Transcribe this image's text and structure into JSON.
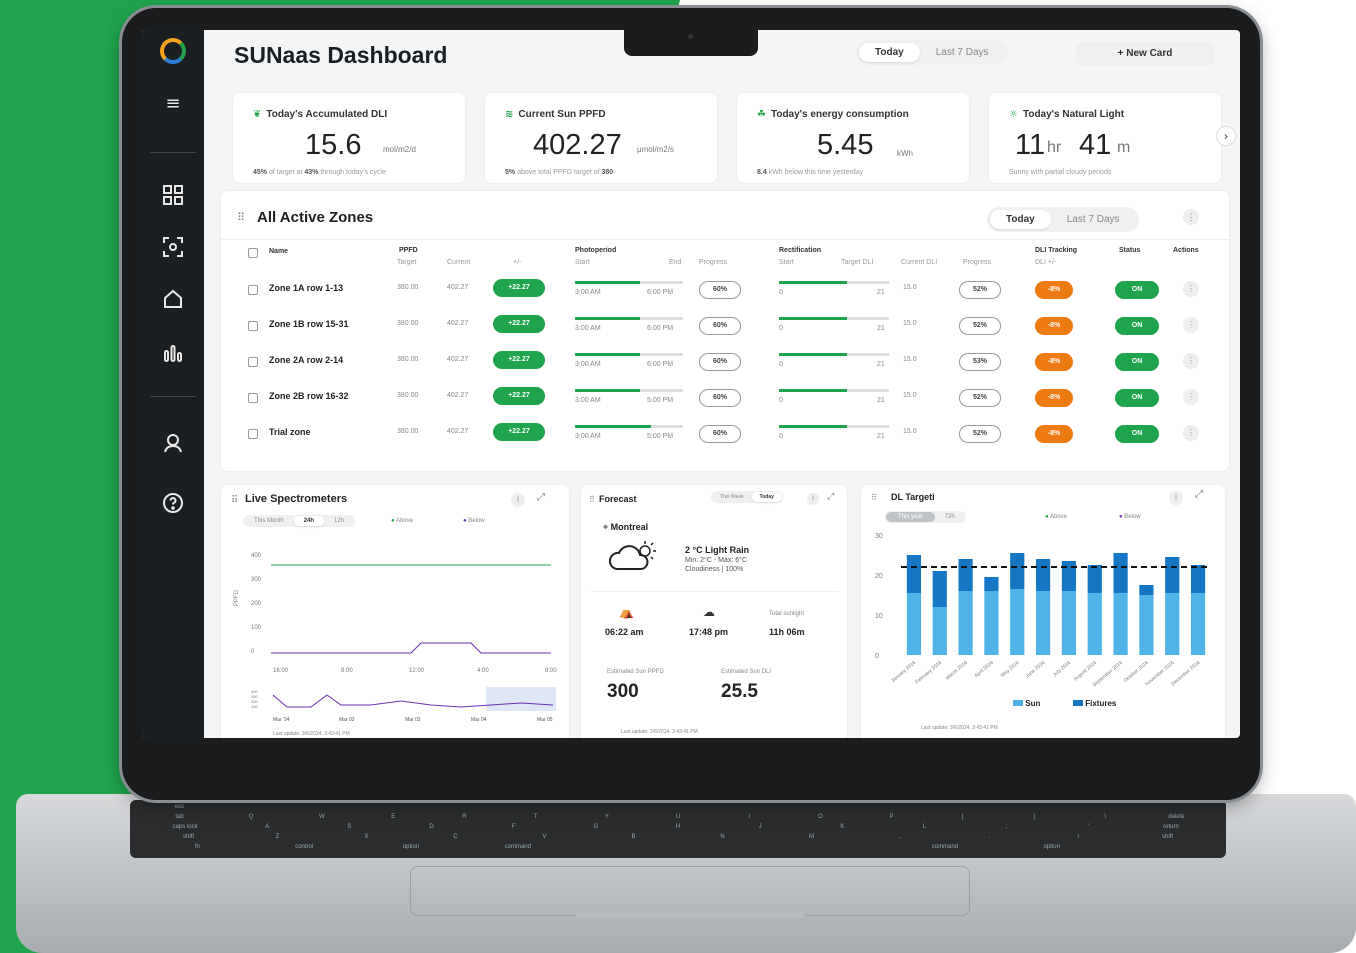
{
  "app": {
    "title": "SUNaas Dashboard",
    "new_card": "+ New Card"
  },
  "range": {
    "today": "Today",
    "last7": "Last 7 Days"
  },
  "kpis": [
    {
      "icon": "seedling-icon",
      "label": "Today's Accumulated DLI",
      "value": "15.6",
      "unit": "mol/m2/d",
      "sub_pre": "45%",
      "sub_mid": " of target at ",
      "sub_bold": "43%",
      "sub_post": " through today's cycle"
    },
    {
      "icon": "waves-icon",
      "label": "Current Sun PPFD",
      "value": "402.27",
      "unit": "μmol/m2/s",
      "sub_pre": "5%",
      "sub_mid": " above total PPFD target of ",
      "sub_bold": "380",
      "sub_post": ""
    },
    {
      "icon": "leaf-energy-icon",
      "label": "Today's energy consumption",
      "value": "5.45",
      "unit": "kWh",
      "sub_pre": "8.4",
      "sub_mid": " kWh below this time yesterday",
      "sub_bold": "",
      "sub_post": ""
    },
    {
      "icon": "sun-icon",
      "label": "Today's Natural Light",
      "value_h": "11",
      "unit_h": "hr",
      "value_m": "41",
      "unit_m": "m",
      "sub": "Sunny with partial cloudy periods"
    }
  ],
  "zones": {
    "title": "All Active Zones",
    "headers": {
      "name": "Name",
      "ppfd": "PPFD",
      "target": "Target",
      "current": "Current",
      "delta": "+/-",
      "photoperiod": "Photoperiod",
      "start": "Start",
      "end": "End",
      "progress": "Progress",
      "rectification": "Rectification",
      "target_dli": "Target DLI",
      "current_dli": "Current DLI",
      "dli_tracking": "DLI Tracking",
      "dli_delta": "DLI +/-",
      "status": "Status",
      "actions": "Actions"
    },
    "rows": [
      {
        "name": "Zone 1A row 1-13",
        "target": "380.00",
        "current": "402.27",
        "delta": "+22.27",
        "start": "3:00 AM",
        "end": "6:00 PM",
        "progress": "60%",
        "photo_frac": 0.6,
        "r_start": "0",
        "r_end": "21",
        "rect_frac": 0.62,
        "cur_dli": "15.0",
        "r_progress": "52%",
        "dli": "-8%",
        "status": "ON"
      },
      {
        "name": "Zone 1B row 15-31",
        "target": "380.00",
        "current": "402.27",
        "delta": "+22.27",
        "start": "3:00 AM",
        "end": "6:00 PM",
        "progress": "60%",
        "photo_frac": 0.6,
        "r_start": "0",
        "r_end": "21",
        "rect_frac": 0.62,
        "cur_dli": "15.0",
        "r_progress": "52%",
        "dli": "-8%",
        "status": "ON"
      },
      {
        "name": "Zone 2A row 2-14",
        "target": "380.00",
        "current": "402.27",
        "delta": "+22.27",
        "start": "3:00 AM",
        "end": "6:00 PM",
        "progress": "60%",
        "photo_frac": 0.6,
        "r_start": "0",
        "r_end": "21",
        "rect_frac": 0.62,
        "cur_dli": "15.0",
        "r_progress": "53%",
        "dli": "-8%",
        "status": "ON"
      },
      {
        "name": "Zone 2B row 16-32",
        "target": "380.00",
        "current": "402.27",
        "delta": "+22.27",
        "start": "3:00 AM",
        "end": "5:00 PM",
        "progress": "60%",
        "photo_frac": 0.6,
        "r_start": "0",
        "r_end": "21",
        "rect_frac": 0.62,
        "cur_dli": "15.0",
        "r_progress": "52%",
        "dli": "-8%",
        "status": "ON"
      },
      {
        "name": "Trial zone",
        "target": "380.00",
        "current": "402.27",
        "delta": "+22.27",
        "start": "3:00 AM",
        "end": "5:00 PM",
        "progress": "60%",
        "photo_frac": 0.7,
        "r_start": "0",
        "r_end": "21",
        "rect_frac": 0.62,
        "cur_dli": "15.0",
        "r_progress": "52%",
        "dli": "-8%",
        "status": "ON"
      }
    ]
  },
  "spectro": {
    "title": "Live Spectrometers",
    "tabs": [
      "This Month",
      "24h",
      "12h"
    ],
    "legend": [
      "Above",
      "Below"
    ],
    "ylabel": "PPFD",
    "yticks": [
      "400",
      "300",
      "200",
      "100",
      "0"
    ],
    "xticks": [
      "16:00",
      "8:00",
      "12:00",
      "4:00",
      "8:00"
    ],
    "mini_yticks": [
      "400",
      "300",
      "200",
      "100"
    ],
    "mini_xticks": [
      "Mar '24",
      "Mar 02",
      "Mar 03",
      "Mar 04",
      "Mar 05"
    ],
    "updated": "Last update: 3/6/2024, 3:43:41 PM"
  },
  "forecast": {
    "title": "Forecast",
    "tabs": [
      "This Week",
      "Today"
    ],
    "city": "Montreal",
    "temp": "2 °C  Light Rain",
    "minmax": "Min: 2°C - Max: 6°C",
    "cloud": "Cloudiness | 100%",
    "sunrise": "06:22 am",
    "sunset": "17:48 pm",
    "total_label": "Total sunlight",
    "total": "11h 06m",
    "ppfd_label": "Estimated Sun PPFD",
    "ppfd": "300",
    "dli_label": "Estimated Sun DLI",
    "dli": "25.5",
    "updated": "Last update: 3/6/2024, 3:43:41 PM"
  },
  "chart_data": {
    "type": "bar",
    "title": "DL Targeti",
    "tabs": [
      "This year",
      "72h"
    ],
    "legend_top": [
      "Above",
      "Below"
    ],
    "categories": [
      "January 2016",
      "February 2016",
      "March 2016",
      "April 2016",
      "May 2016",
      "June 2016",
      "July 2016",
      "August 2016",
      "September 2016",
      "October 2016",
      "November 2016",
      "December 2016"
    ],
    "series": [
      {
        "name": "Sun",
        "values": [
          15.5,
          12,
          16,
          16,
          16.5,
          16,
          16,
          15.5,
          15.5,
          15,
          15.5,
          15.5
        ],
        "color": "#4fb3e8"
      },
      {
        "name": "Fixtures",
        "values": [
          9.5,
          9,
          8,
          3.5,
          9,
          8,
          7.5,
          7,
          10,
          2.5,
          9,
          7
        ],
        "color": "#1576c4"
      }
    ],
    "target": 22,
    "yticks": [
      "30",
      "20",
      "10",
      "0"
    ],
    "ylim": [
      0,
      30
    ],
    "updated": "Last update: 3/6/2024, 3:43:41 PM"
  }
}
